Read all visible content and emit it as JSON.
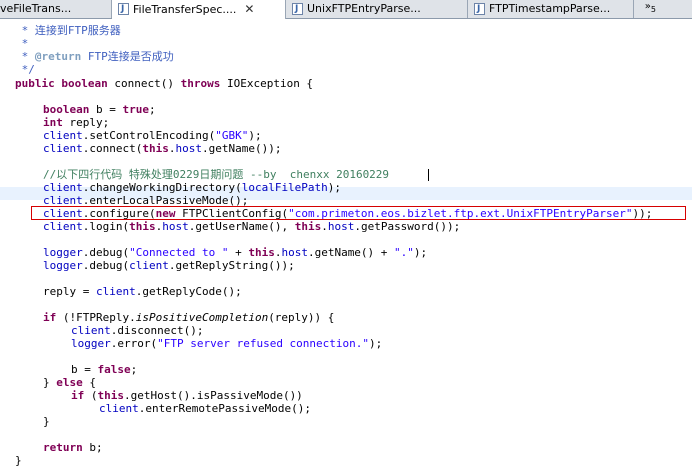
{
  "tabs": [
    {
      "label": "veFileTrans..."
    },
    {
      "label": "FileTransferSpec...."
    },
    {
      "label": "UnixFTPEntryParse..."
    },
    {
      "label": "FTPTimestampParse..."
    }
  ],
  "tab_close": "✕",
  "overflow": {
    "chevron": "»",
    "count": "5"
  },
  "code": {
    "c1_star": " * ",
    "c1_text": "连接到FTP服务器",
    "c2": " *",
    "c3_star": " * ",
    "c3_tag": "@return",
    "c3_text": " FTP连接是否成功",
    "c4": " */",
    "sig_public": "public",
    "sig_boolean": "boolean",
    "sig_name": " connect() ",
    "sig_throws": "throws",
    "sig_exc": " IOException {",
    "b_type": "boolean",
    "b_rest": " b = ",
    "b_val": "true",
    "b_end": ";",
    "r_type": "int",
    "r_rest": " reply;",
    "enc_client": "client",
    "enc_call": ".setControlEncoding(",
    "enc_str": "\"GBK\"",
    "enc_end": ");",
    "con_client": "client",
    "con_call": ".connect(",
    "con_this": "this",
    "con_dot": ".",
    "con_host": "host",
    "con_end": ".getName());",
    "cmt_text": "//以下四行代码 特殊处理0229日期问题 --by  chenxx 20160229",
    "cwd_client": "client",
    "cwd_call": ".changeWorkingDirectory(",
    "cwd_arg": "localFilePath",
    "cwd_end": ");",
    "epm_client": "client",
    "epm_call": ".enterLocalPassiveMode();",
    "cfg_client": "client",
    "cfg_call": ".configure(",
    "cfg_new": "new",
    "cfg_cls": " FTPClientConfig(",
    "cfg_str": "\"com.primeton.eos.bizlet.ftp.ext.UnixFTPEntryParser\"",
    "cfg_end": "));",
    "lg_client": "client",
    "lg_call": ".login(",
    "lg_this1": "this",
    "lg_dot1": ".",
    "lg_host1": "host",
    "lg_mid": ".getUserName(), ",
    "lg_this2": "this",
    "lg_dot2": ".",
    "lg_host2": "host",
    "lg_end": ".getPassword());",
    "d1_logger": "logger",
    "d1_call": ".debug(",
    "d1_str1": "\"Connected to \"",
    "d1_plus": " + ",
    "d1_this": "this",
    "d1_dot": ".",
    "d1_host": "host",
    "d1_mid": ".getName() + ",
    "d1_str2": "\".\"",
    "d1_end": ");",
    "d2_logger": "logger",
    "d2_call": ".debug(",
    "d2_client": "client",
    "d2_end": ".getReplyString());",
    "rp_start": "reply = ",
    "rp_client": "client",
    "rp_end": ".getReplyCode();",
    "if1_kw": "if",
    "if1_open": " (!FTPReply.",
    "if1_method": "isPositiveCompletion",
    "if1_end": "(reply)) {",
    "dis_client": "client",
    "dis_end": ".disconnect();",
    "err_logger": "logger",
    "err_call": ".error(",
    "err_str": "\"FTP server refused connection.\"",
    "err_end": ");",
    "bf_start": "b = ",
    "bf_val": "false",
    "bf_end": ";",
    "else_open": "} ",
    "else_kw": "else",
    "else_end": " {",
    "if2_kw": "if",
    "if2_open": " (",
    "if2_this": "this",
    "if2_end": ".getHost().isPassiveMode())",
    "erp_client": "client",
    "erp_end": ".enterRemotePassiveMode();",
    "close1": "}",
    "ret_kw": "return",
    "ret_end": " b;",
    "close2": "}"
  },
  "colors": {
    "keyword": "#7f0055",
    "javadoc": "#3f5fbf",
    "field": "#0000c0",
    "string": "#2a00ff",
    "highlight_box": "#d60000",
    "current_line": "#e8f2fe"
  }
}
